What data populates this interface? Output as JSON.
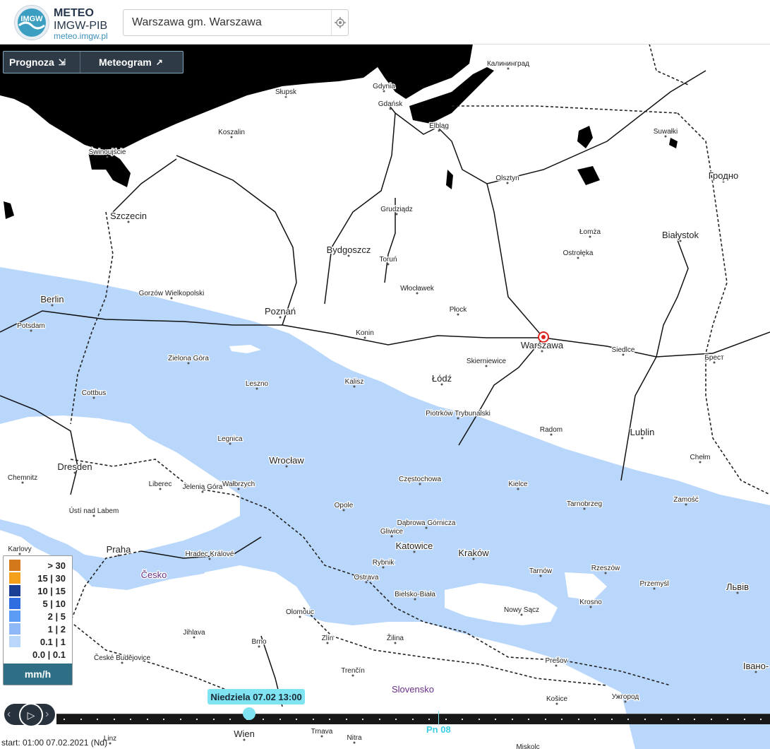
{
  "header": {
    "logo_line1": "METEO",
    "logo_line2": "IMGW-PIB",
    "logo_url": "meteo.imgw.pl",
    "logo_mark": "IMGW",
    "search_value": "Warszawa gm. Warszawa"
  },
  "tabs": [
    {
      "label": "Prognoza",
      "icon": "arrow-down-right-icon"
    },
    {
      "label": "Meteogram",
      "icon": "chart-trend-icon"
    }
  ],
  "map": {
    "colors": {
      "land": "#ffffff",
      "sea": "#000000",
      "precip": "#b9d6fb",
      "roads": "#111111",
      "borders": "#333333"
    },
    "labels": [
      {
        "text": "Калининград",
        "major": false
      },
      {
        "text": "Gdynia",
        "major": false
      },
      {
        "text": "Gdańsk",
        "major": false
      },
      {
        "text": "Elbląg",
        "major": false
      },
      {
        "text": "Słupsk",
        "major": false
      },
      {
        "text": "Koszalin",
        "major": false
      },
      {
        "text": "Świnoujście",
        "major": false
      },
      {
        "text": "Szczecin",
        "major": true
      },
      {
        "text": "Suwałki",
        "major": false
      },
      {
        "text": "Гродно",
        "major": true
      },
      {
        "text": "Olsztyn",
        "major": false
      },
      {
        "text": "Grudziądz",
        "major": false
      },
      {
        "text": "Bydgoszcz",
        "major": true
      },
      {
        "text": "Toruń",
        "major": false
      },
      {
        "text": "Łomża",
        "major": false
      },
      {
        "text": "Białystok",
        "major": true
      },
      {
        "text": "Ostrołęka",
        "major": false
      },
      {
        "text": "Berlin",
        "major": true
      },
      {
        "text": "Potsdam",
        "major": false
      },
      {
        "text": "Gorzów Wielkopolski",
        "major": false
      },
      {
        "text": "Poznań",
        "major": true
      },
      {
        "text": "Włocławek",
        "major": false
      },
      {
        "text": "Płock",
        "major": false
      },
      {
        "text": "Konin",
        "major": false
      },
      {
        "text": "Warszawa",
        "major": true
      },
      {
        "text": "Siedlce",
        "major": false
      },
      {
        "text": "Брест",
        "major": false
      },
      {
        "text": "Zielona Góra",
        "major": false
      },
      {
        "text": "Skierniewice",
        "major": false
      },
      {
        "text": "Kalisz",
        "major": false
      },
      {
        "text": "Leszno",
        "major": false
      },
      {
        "text": "Łódź",
        "major": true
      },
      {
        "text": "Cottbus",
        "major": false
      },
      {
        "text": "Piotrków Trybunalski",
        "major": false
      },
      {
        "text": "Radom",
        "major": false
      },
      {
        "text": "Lublin",
        "major": true
      },
      {
        "text": "Chełm",
        "major": false
      },
      {
        "text": "Legnica",
        "major": false
      },
      {
        "text": "Dresden",
        "major": true
      },
      {
        "text": "Wrocław",
        "major": true
      },
      {
        "text": "Chemnitz",
        "major": false
      },
      {
        "text": "Liberec",
        "major": false
      },
      {
        "text": "Jelenia Góra",
        "major": false
      },
      {
        "text": "Wałbrzych",
        "major": false
      },
      {
        "text": "Częstochowa",
        "major": false
      },
      {
        "text": "Kielce",
        "major": false
      },
      {
        "text": "Zamość",
        "major": false
      },
      {
        "text": "Tarnobrzeg",
        "major": false
      },
      {
        "text": "Ústí nad Labem",
        "major": false
      },
      {
        "text": "Opole",
        "major": false
      },
      {
        "text": "Dąbrowa Górnicza",
        "major": false
      },
      {
        "text": "Gliwice",
        "major": false
      },
      {
        "text": "Katowice",
        "major": true
      },
      {
        "text": "Karlovy",
        "major": false
      },
      {
        "text": "Praha",
        "major": true
      },
      {
        "text": "Hradec Králové",
        "major": false
      },
      {
        "text": "Rybnik",
        "major": false
      },
      {
        "text": "Kraków",
        "major": true
      },
      {
        "text": "Rzeszów",
        "major": false
      },
      {
        "text": "Tarnów",
        "major": false
      },
      {
        "text": "Česko",
        "major": true
      },
      {
        "text": "Ostrava",
        "major": false
      },
      {
        "text": "Bielsko-Biała",
        "major": false
      },
      {
        "text": "Przemyśl",
        "major": false
      },
      {
        "text": "Львів",
        "major": true
      },
      {
        "text": "Olomouc",
        "major": false
      },
      {
        "text": "Nowy Sącz",
        "major": false
      },
      {
        "text": "Krosno",
        "major": false
      },
      {
        "text": "Jihlava",
        "major": false
      },
      {
        "text": "Brno",
        "major": false
      },
      {
        "text": "Zlín",
        "major": false
      },
      {
        "text": "Žilina",
        "major": false
      },
      {
        "text": "České Budějovice",
        "major": false
      },
      {
        "text": "Prešov",
        "major": false
      },
      {
        "text": "Івано-",
        "major": true
      },
      {
        "text": "Trenčín",
        "major": false
      },
      {
        "text": "Slovensko",
        "major": true
      },
      {
        "text": "Košice",
        "major": false
      },
      {
        "text": "Ужгород",
        "major": false
      },
      {
        "text": "Linz",
        "major": false
      },
      {
        "text": "Wien",
        "major": true
      },
      {
        "text": "Trnava",
        "major": false
      },
      {
        "text": "Nitra",
        "major": false
      },
      {
        "text": "Miskolc",
        "major": false
      }
    ]
  },
  "legend": {
    "items": [
      {
        "label": "> 30",
        "color": "#d4781c"
      },
      {
        "label": "15 | 30",
        "color": "#f4a01b"
      },
      {
        "label": "10 | 15",
        "color": "#1a3f94"
      },
      {
        "label": "5 | 10",
        "color": "#2f6ee0"
      },
      {
        "label": "2 | 5",
        "color": "#5d9cf5"
      },
      {
        "label": "1 | 2",
        "color": "#8eb8f7"
      },
      {
        "label": "0.1 | 1",
        "color": "#b9d6fb"
      },
      {
        "label": "0.0 | 0.1",
        "color": "#ffffff"
      }
    ],
    "unit": "mm/h"
  },
  "timeline": {
    "current": "Niedziela 07.02 13:00",
    "day_marker": "Pn 08",
    "start": "start: 01:00 07.02.2021 (Nd)",
    "progress": 0.27
  }
}
